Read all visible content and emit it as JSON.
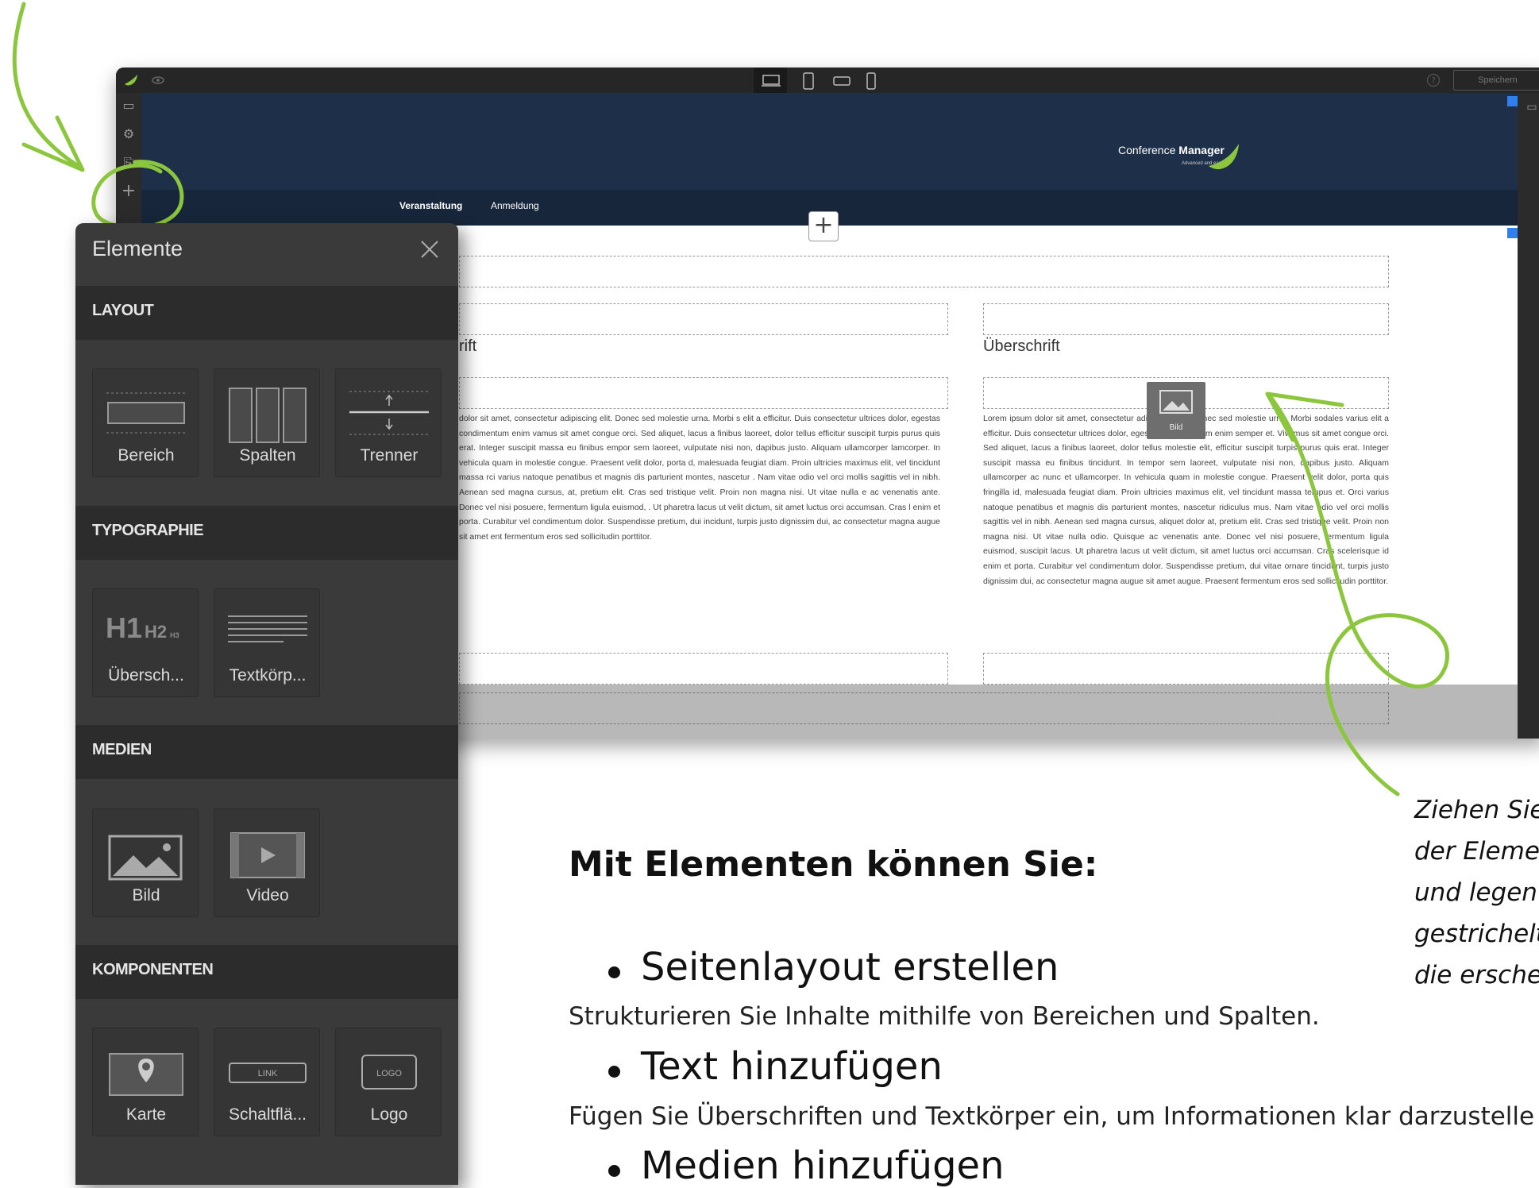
{
  "app": {
    "save_button": "Speichern",
    "help_icon": "?"
  },
  "website": {
    "logo_text_light": "Conference ",
    "logo_text_bold": "Manager",
    "logo_tagline": "Advanced and easy",
    "nav": [
      "Veranstaltung",
      "Anmeldung"
    ],
    "column_title_left": "rift",
    "column_title_right": "Überschrift",
    "image_placeholder": "Bild",
    "lorem_left": "dolor sit amet, consectetur adipiscing elit. Donec sed molestie urna. Morbi s elit a efficitur. Duis consectetur ultrices dolor, egestas condimentum enim vamus sit amet congue orci. Sed aliquet, lacus a finibus laoreet, dolor tellus efficitur suscipit turpis purus quis erat. Integer suscipit massa eu finibus empor sem laoreet, vulputate nisi non, dapibus justo. Aliquam ullamcorper lamcorper. In vehicula quam in molestie congue. Praesent velit dolor, porta d, malesuada feugiat diam. Proin ultricies maximus elit, vel tincidunt massa rci varius natoque penatibus et magnis dis parturient montes, nascetur . Nam vitae odio vel orci mollis sagittis vel in nibh. Aenean sed magna cursus, at, pretium elit. Cras sed tristique velit. Proin non magna nisi. Ut vitae nulla e ac venenatis ante. Donec vel nisi posuere, fermentum ligula euismod, . Ut pharetra lacus ut velit dictum, sit amet luctus orci accumsan. Cras l enim et porta. Curabitur vel condimentum dolor. Suspendisse pretium, dui incidunt, turpis justo dignissim dui, ac consectetur magna augue sit amet ent fermentum eros sed sollicitudin porttitor.",
    "lorem_right": "Lorem ipsum dolor sit amet, consectetur adipiscing elit. Donec sed molestie urna. Morbi sodales varius elit a efficitur. Duis consectetur ultrices dolor, egestas condimentum enim semper et. Vivamus sit amet congue orci. Sed aliquet, lacus a finibus laoreet, dolor tellus molestie elit, efficitur suscipit turpis purus quis erat. Integer suscipit massa eu finibus tincidunt. In tempor sem laoreet, vulputate nisi non, dapibus justo. Aliquam ullamcorper ac nunc et ullamcorper. In vehicula quam in molestie congue. Praesent velit dolor, porta quis fringilla id, malesuada feugiat diam. Proin ultricies maximus elit, vel tincidunt massa tempus et. Orci varius natoque penatibus et magnis dis parturient montes, nascetur ridiculus mus. Nam vitae odio vel orci mollis sagittis vel in nibh. Aenean sed magna cursus, aliquet dolor at, pretium elit. Cras sed tristique velit. Proin non magna nisi. Ut vitae nulla odio. Quisque ac venenatis ante. Donec vel nisi posuere, fermentum ligula euismod, suscipit lacus. Ut pharetra lacus ut velit dictum, sit amet luctus orci accumsan. Cras scelerisque id enim et porta. Curabitur vel condimentum dolor. Suspendisse pretium, dui vitae ornare tincidunt, turpis justo dignissim dui, ac consectetur magna augue sit amet augue. Praesent fermentum eros sed sollicitudin porttitor."
  },
  "panel": {
    "title": "Elemente",
    "sections": [
      {
        "title": "LAYOUT",
        "items": [
          "Bereich",
          "Spalten",
          "Trenner"
        ]
      },
      {
        "title": "TYPOGRAPHIE",
        "items": [
          "Übersch...",
          "Textkörp..."
        ]
      },
      {
        "title": "MEDIEN",
        "items": [
          "Bild",
          "Video"
        ]
      },
      {
        "title": "KOMPONENTEN",
        "items": [
          "Karte",
          "Schaltflä...",
          "Logo"
        ]
      }
    ],
    "h1": "H1",
    "h2": "H2",
    "h3": "H3",
    "link_text": "LINK",
    "logo_text": "LOGO"
  },
  "content": {
    "heading": "Mit Elementen können Sie:",
    "items": [
      {
        "title": "Seitenlayout erstellen",
        "desc": "Strukturieren Sie Inhalte mithilfe von Bereichen und Spalten."
      },
      {
        "title": "Text hinzufügen",
        "desc": "Fügen Sie Überschriften und Textkörper ein, um Informationen klar darzustelle"
      },
      {
        "title": "Medien hinzufügen",
        "desc": ""
      }
    ],
    "side_note": [
      "Ziehen Sie",
      "der Elemen",
      "und legen S",
      "gestrichelte",
      "die erschei"
    ]
  },
  "colors": {
    "accent_green": "#8cc63f",
    "header_navy": "#1e3049",
    "panel_bg": "#3a3a3a",
    "section_bg": "#2c2c2c"
  }
}
